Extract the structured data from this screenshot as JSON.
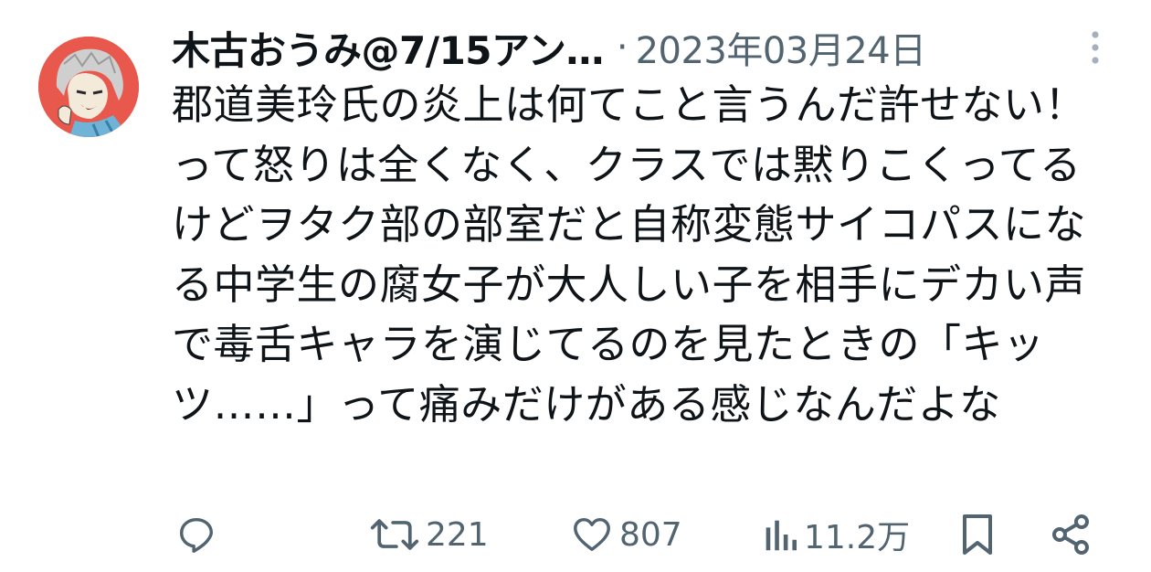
{
  "tweet": {
    "author": {
      "display_name": "木古おうみ@7/15アン…",
      "avatar_icon": "user-avatar-icon"
    },
    "separator": "·",
    "timestamp": "2023年03月24日",
    "text": "郡道美玲氏の炎上は何てこと言うんだ許せない！って怒りは全くなく、クラスでは黙りこくってるけどヲタク部の部室だと自称変態サイコパスになる中学生の腐女子が大人しい子を相手にデカい声で毒舌キャラを演じてるのを見たときの「キッツ……」って痛みだけがある感じなんだよな",
    "actions": {
      "reply": {
        "icon": "reply-icon"
      },
      "retweet": {
        "icon": "retweet-icon",
        "count": "221"
      },
      "like": {
        "icon": "heart-icon",
        "count": "807"
      },
      "views": {
        "icon": "views-chart-icon",
        "count": "11.2万"
      },
      "bookmark": {
        "icon": "bookmark-icon"
      },
      "share": {
        "icon": "share-icon"
      }
    },
    "more_icon": "more-vertical-icon"
  },
  "colors": {
    "text_primary": "#0f1419",
    "text_secondary": "#536471",
    "avatar_bg": "#e8584c"
  }
}
